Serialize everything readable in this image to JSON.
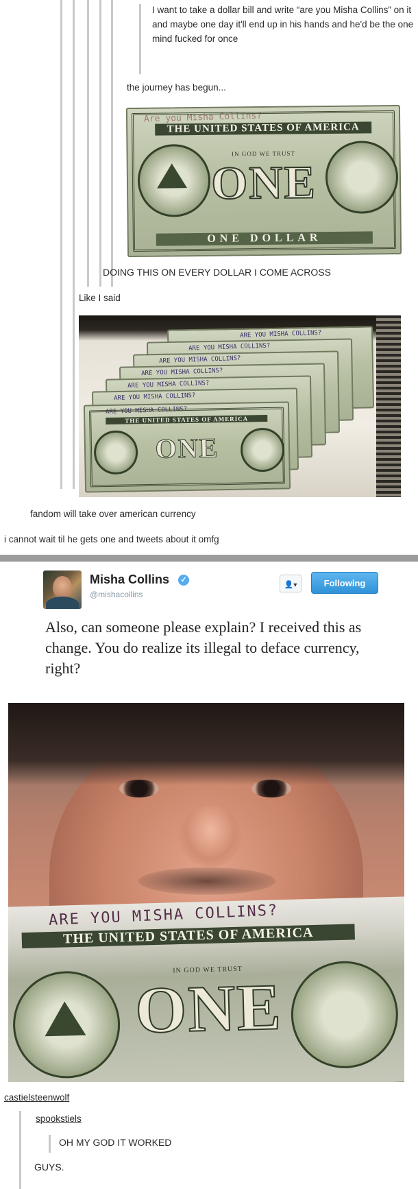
{
  "top_post": {
    "quote1": "I want to take a dollar bill and write “are you Misha Collins” on it and maybe one day it'll end up in his hands and he'd be the one mind fucked for once",
    "reply1": "the journey has begun...",
    "bill1": {
      "handwriting": "Are you Misha Collins?",
      "banner": "THE UNITED STATES OF AMERICA",
      "motto": "IN GOD WE TRUST",
      "denom": "ONE",
      "bottom": "ONE DOLLAR"
    },
    "caption1": "DOING THIS ON EVERY DOLLAR I COME ACROSS",
    "reply2": "Like I said",
    "bills_stack": {
      "handwriting": [
        "ARE YOU MISHA COLLINS?",
        "ARE YOU MISHA COLLINS?",
        "ARE YOU MISHA COLLINS?",
        "ARE YOU MISHA COLLINS?",
        "ARE YOU MISHA COLLINS?",
        "ARE YOU MISHA COLLINS?",
        "ARE YOU MISHA COLLINS?"
      ],
      "banner": "THE UNITED STATES OF AMERICA",
      "denom": "ONE"
    },
    "reply3": "fandom will take over american currency",
    "reply4": "i cannot wait til he gets one and tweets about it omfg"
  },
  "tweet": {
    "name": "Misha Collins",
    "handle": "@mishacollins",
    "verified_glyph": "✓",
    "follow_icon": "person-add-icon",
    "follow_glyph": "👤",
    "follow_caret": "▾",
    "following_label": "Following",
    "text": "Also, can someone please explain? I received this as change. You do realize its illegal to deface currency, right?",
    "bill": {
      "handwriting": "ARE YOU MISHA COLLINS?",
      "banner": "THE UNITED STATES OF AMERICA",
      "motto": "IN GOD WE TRUST",
      "denom": "ONE"
    }
  },
  "bottom_post": {
    "user1": "castielsteenwolf",
    "user2": "spookstiels",
    "reply1": "OH MY GOD IT WORKED",
    "reply2": "GUYS."
  },
  "colors": {
    "following_blue": "#2e92d8",
    "verified_blue": "#55acee",
    "separator": "#9b9b9b"
  }
}
